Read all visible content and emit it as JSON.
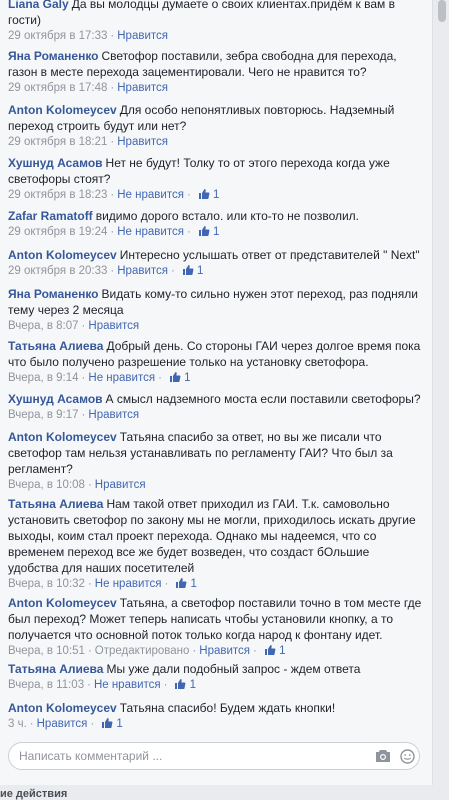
{
  "comments": [
    {
      "author": "Liana Galy",
      "text": "Да вы молодцы думаете о своих клиентах.придём к вам в гости)",
      "meta": {
        "date": "29 октября в 17:33",
        "like_label": "Нравится"
      }
    },
    {
      "author": "Яна Романенко",
      "text": "Светофор поставили, зебра свободна для перехода, газон в месте перехода зацементировали. Чего не нравится то?",
      "meta": {
        "date": "29 октября в 17:48",
        "like_label": "Нравится"
      }
    },
    {
      "author": "Anton Kolomeycev",
      "text": "Для особо непонятливых повторюсь. Надземный переход строить будут или нет?",
      "meta": {
        "date": "29 октября в 18:21",
        "like_label": "Нравится"
      }
    },
    {
      "author": "Хушнуд Асамов",
      "text": "Нет не будут! Толку то от этого перехода когда уже светофоры стоят?",
      "meta": {
        "date": "29 октября в 18:23",
        "like_label": "Не нравится",
        "likes": "1"
      }
    },
    {
      "author": "Zafar Ramatoff",
      "text": "видимо дорого встало. или кто-то не позволил.",
      "meta": {
        "date": "29 октября в 19:24",
        "like_label": "Не нравится",
        "likes": "1"
      }
    },
    {
      "author": "Anton Kolomeycev",
      "text": "Интересно услышать ответ от представителей \" Next\"",
      "meta": {
        "date": "29 октября в 20:33",
        "like_label": "Нравится",
        "likes": "1"
      }
    },
    {
      "author": "Яна Романенко",
      "text": "Видать кому-то сильно нужен этот переход, раз подняли тему через 2 месяца",
      "meta": {
        "date": "Вчера, в 8:07",
        "like_label": "Нравится"
      }
    },
    {
      "author": "Татьяна Алиева",
      "text": "Добрый день. Со стороны ГАИ через долгое время пока что было получено разрешение только на установку светофора.",
      "meta": {
        "date": "Вчера, в 9:14",
        "like_label": "Не нравится",
        "likes": "1"
      }
    },
    {
      "author": "Хушнуд Асамов",
      "text": "А смысл надземного моста если поставили светофоры?",
      "meta": {
        "date": "Вчера, в 9:17",
        "like_label": "Нравится"
      }
    },
    {
      "author": "Anton Kolomeycev",
      "text": "Татьяна спасибо за ответ, но вы же писали что светофор там нельзя устанавливать по регламенту ГАИ? Что был за регламент?",
      "meta": {
        "date": "Вчера, в 10:08",
        "like_label": "Нравится"
      }
    },
    {
      "author": "Татьяна Алиева",
      "text": "Нам такой ответ приходил из ГАИ. Т.к. самовольно установить светофор по закону мы не могли, приходилось искать другие выходы, коим стал проект перехода. Однако мы надеемся, что со временем переход все же будет возведен, что создаст бОльшие удобства для наших посетителей",
      "meta": {
        "date": "Вчера, в 10:32",
        "like_label": "Не нравится",
        "likes": "1"
      }
    },
    {
      "author": "Anton Kolomeycev",
      "text": "Татьяна, а светофор поставили точно в том месте где был переход? Может теперь написать чтобы установили кнопку, а то получается что основной поток только когда народ к фонтану идет.",
      "meta": {
        "date": "Вчера, в 10:51",
        "edited_label": "Отредактировано",
        "like_label": "Нравится",
        "likes": "1"
      }
    },
    {
      "author": "Татьяна Алиева",
      "text": "Мы уже дали подобный запрос - ждем ответа",
      "meta": {
        "date": "Вчера, в 11:03",
        "like_label": "Не нравится",
        "likes": "1"
      }
    },
    {
      "author": "Anton Kolomeycev",
      "text": "Татьяна спасибо! Будем ждать кнопки!",
      "meta": {
        "date": "3 ч.",
        "like_label": "Нравится",
        "likes": "1"
      }
    }
  ],
  "composer": {
    "placeholder": "Написать комментарий ..."
  },
  "footer": {
    "text": "ие действия"
  },
  "icons": {
    "like": "thumbs-up-icon",
    "camera": "camera-icon",
    "smile": "smile-icon"
  },
  "colors": {
    "author": "#365899",
    "link": "#4267b2",
    "meta": "#90949c"
  }
}
